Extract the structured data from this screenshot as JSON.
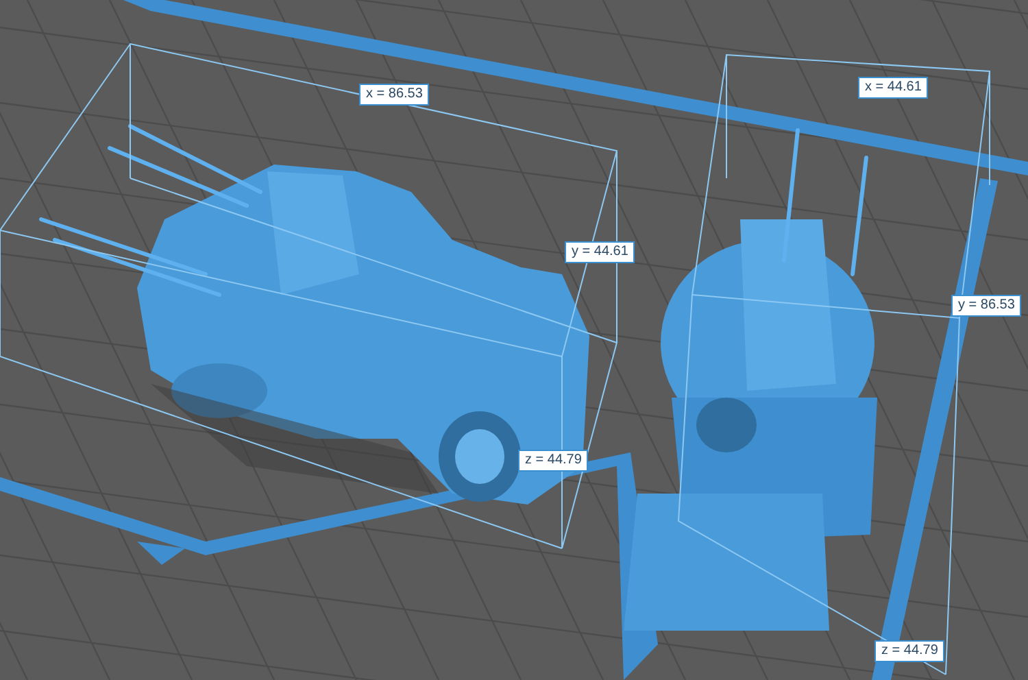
{
  "models": [
    {
      "dimensions": {
        "x": "x = 86.53",
        "y": "y = 44.61",
        "z": "z = 44.79"
      }
    },
    {
      "dimensions": {
        "x": "x = 44.61",
        "y": "y = 86.53",
        "z": "z = 44.79"
      }
    }
  ]
}
